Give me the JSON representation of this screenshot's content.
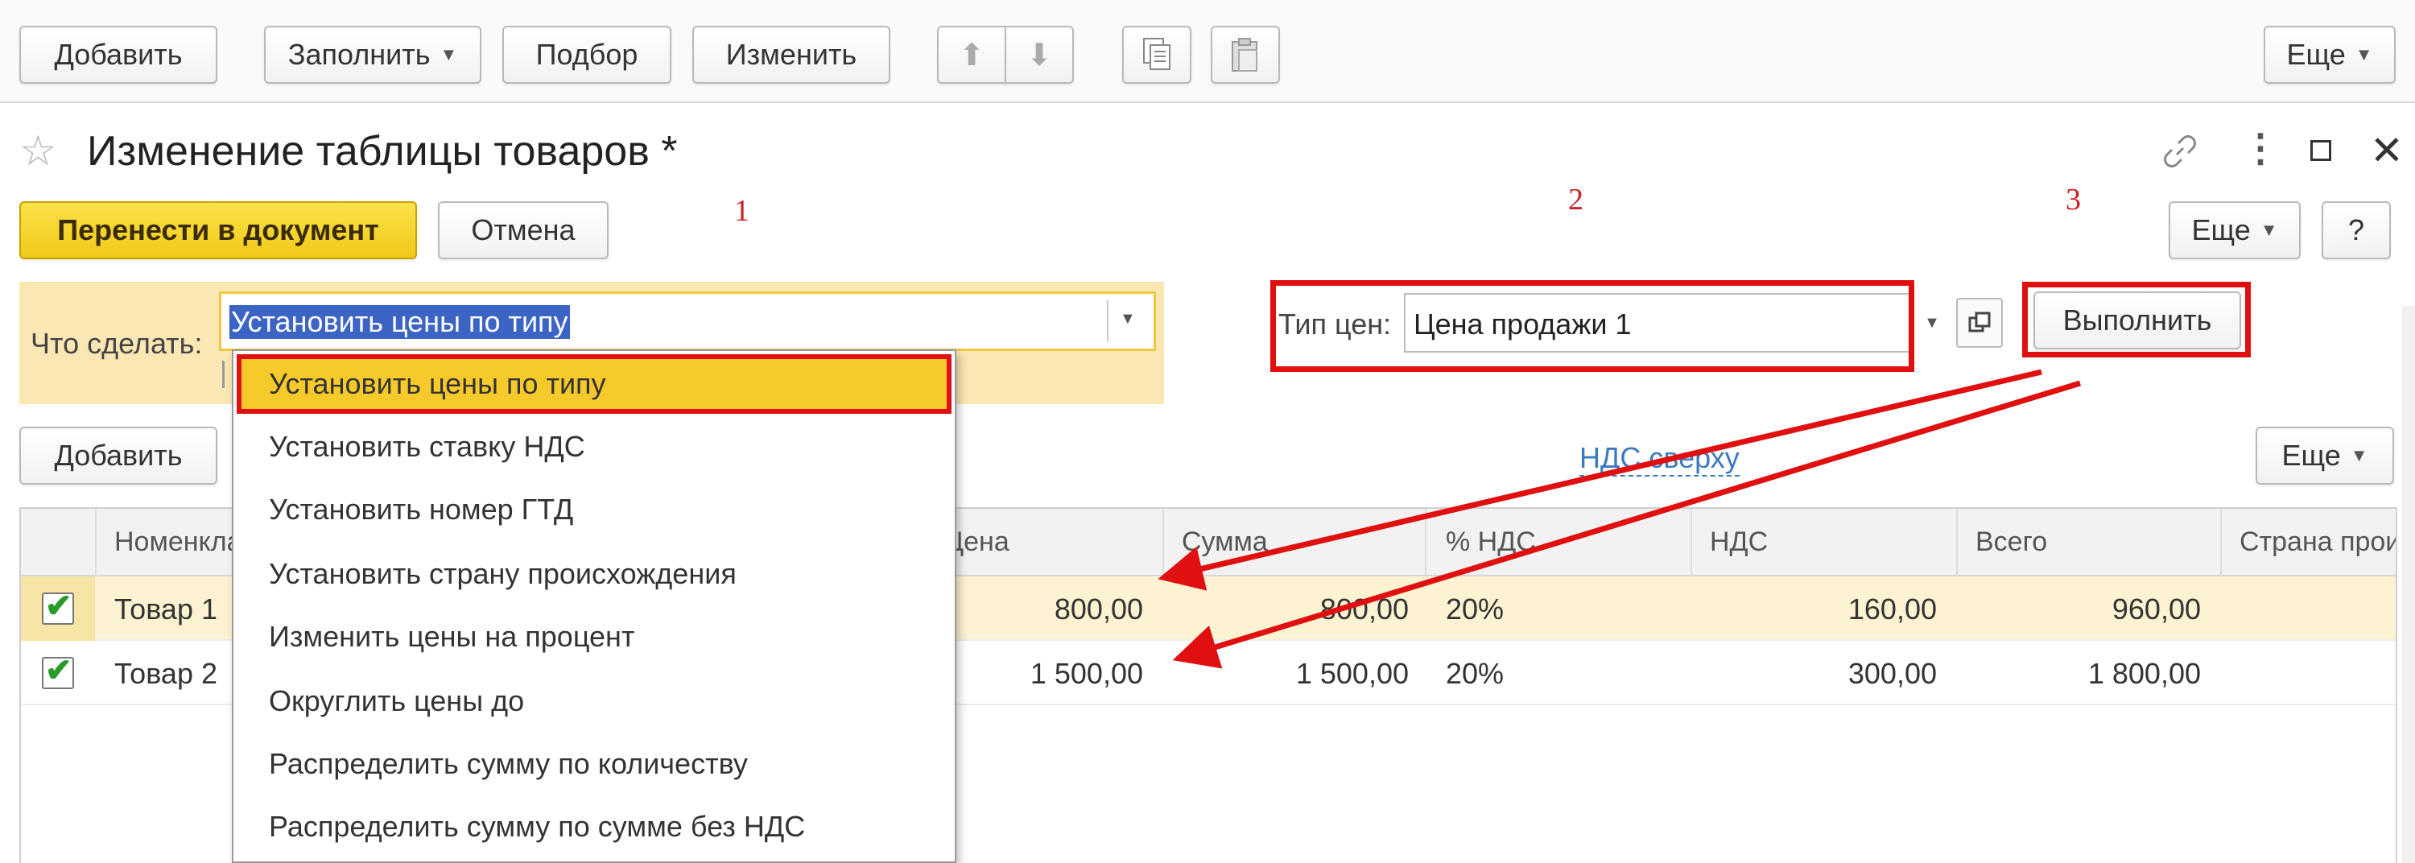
{
  "top_toolbar": {
    "add": "Добавить",
    "fill": "Заполнить",
    "pick": "Подбор",
    "change": "Изменить",
    "more": "Еще"
  },
  "dialog": {
    "title": "Изменение таблицы товаров *",
    "transfer": "Перенести в документ",
    "cancel": "Отмена",
    "more": "Еще",
    "help": "?"
  },
  "annotations": {
    "n1": "1",
    "n2": "2",
    "n3": "3"
  },
  "action_panel": {
    "what_label": "Что сделать:",
    "what_value": "Установить цены по типу",
    "price_type_label": "Тип цен:",
    "price_type_value": "Цена продажи 1",
    "execute": "Выполнить"
  },
  "dropdown": {
    "items": [
      "Установить цены по типу",
      "Установить ставку НДС",
      "Установить номер ГТД",
      "Установить страну происхождения",
      "Изменить цены на процент",
      "Округлить цены до",
      "Распределить сумму по количеству",
      "Распределить сумму по сумме без НДС"
    ]
  },
  "table_toolbar": {
    "add": "Добавить",
    "vat_link": "НДС сверху",
    "more": "Еще"
  },
  "table": {
    "headers": {
      "name": "Номенклатура",
      "price": "Цена",
      "sum": "Сумма",
      "vat_pct": "% НДС",
      "vat": "НДС",
      "total": "Всего",
      "country": "Страна происхождения"
    },
    "rows": [
      {
        "checked": true,
        "name": "Товар 1",
        "price": "800,00",
        "sum": "800,00",
        "vat_pct": "20%",
        "vat": "160,00",
        "total": "960,00"
      },
      {
        "checked": true,
        "name": "Товар 2",
        "price": "1 500,00",
        "sum": "1 500,00",
        "vat_pct": "20%",
        "vat": "300,00",
        "total": "1 800,00"
      }
    ]
  },
  "colors": {
    "yellow_button": "#f5d320",
    "panel_bg": "#fbe7b4",
    "selected_row": "#fdf3d2",
    "highlight": "#f6ca2b",
    "annotation_red": "#e01010",
    "link": "#3a7bbf"
  }
}
